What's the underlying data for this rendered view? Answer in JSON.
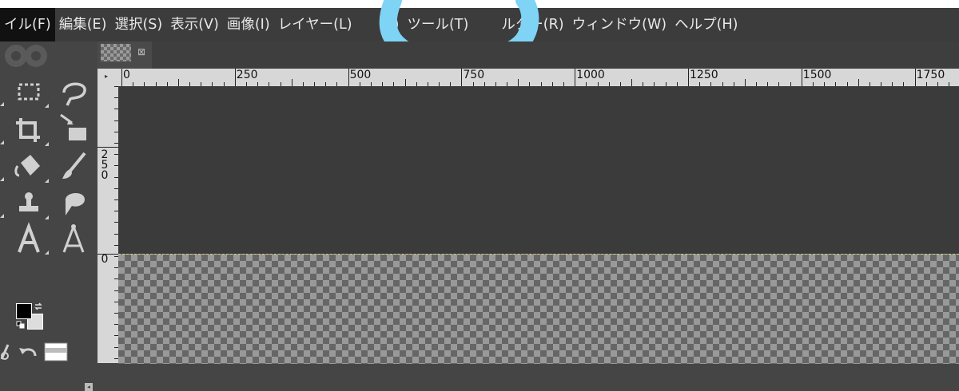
{
  "menubar": {
    "items": [
      {
        "label": "イル(F)",
        "active": true
      },
      {
        "label": "編集(E)"
      },
      {
        "label": "選択(S)"
      },
      {
        "label": "表示(V)"
      },
      {
        "label": "画像(I)"
      },
      {
        "label": "レイヤー(L)"
      },
      {
        "label": "(C)"
      },
      {
        "label": "ツール(T)"
      },
      {
        "label": "ルター(R)"
      },
      {
        "label": "ウィンドウ(W)"
      },
      {
        "label": "ヘルプ(H)"
      }
    ]
  },
  "annotation": {
    "color": "#7fd3f5"
  },
  "image_tab": {
    "close_glyph": "⊠"
  },
  "toolbox": {
    "tools": [
      {
        "name": "rect-select-icon"
      },
      {
        "name": "free-select-icon"
      },
      {
        "name": "crop-icon"
      },
      {
        "name": "warp-transform-icon"
      },
      {
        "name": "bucket-fill-icon"
      },
      {
        "name": "paintbrush-icon"
      },
      {
        "name": "clone-stamp-icon"
      },
      {
        "name": "smudge-icon"
      },
      {
        "name": "text-tool-icon"
      },
      {
        "name": "measure-icon"
      }
    ],
    "fg_color": "#000000",
    "bg_color": "#dcdcdc"
  },
  "ruler": {
    "h_labels": [
      "0",
      "250",
      "500",
      "750",
      "1000",
      "1250",
      "1500",
      "1750"
    ],
    "v_labels": [
      "2",
      "5",
      "0"
    ],
    "v_zero": "0"
  },
  "colors": {
    "ui_bg": "#454545",
    "menubar_bg": "#3c3c3c",
    "ruler_bg": "#d7d7d7",
    "canvas_bg": "#3b3b3b"
  }
}
